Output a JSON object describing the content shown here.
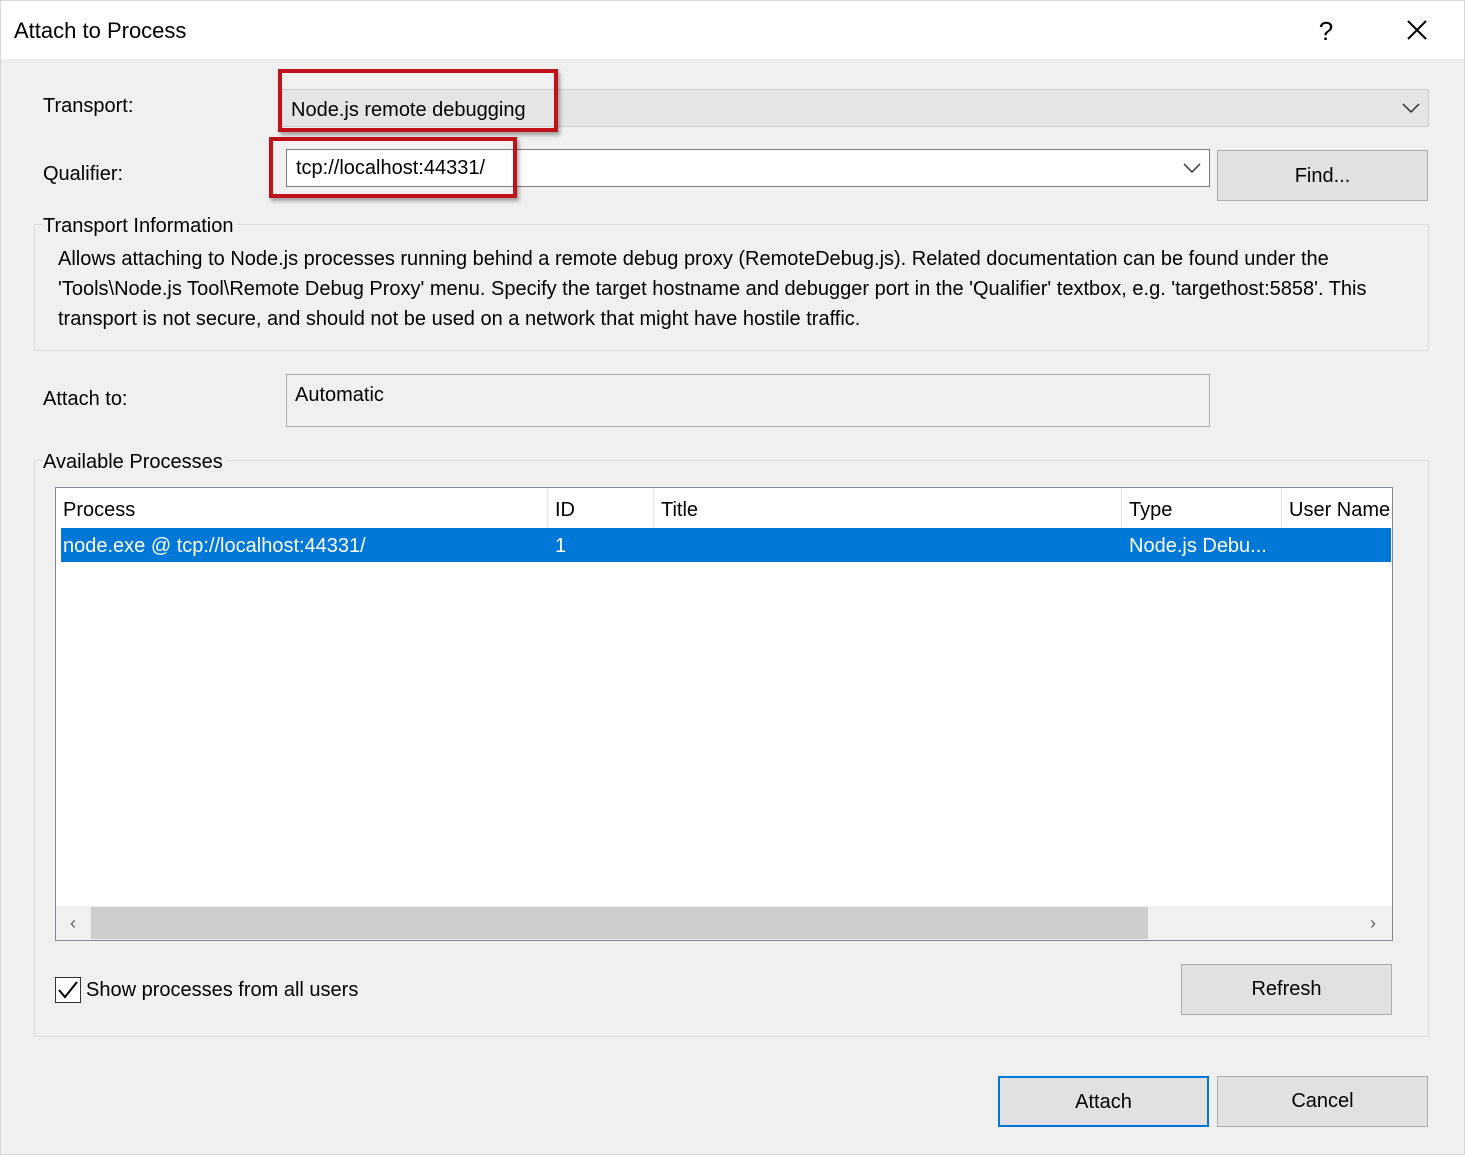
{
  "window": {
    "title": "Attach to Process",
    "help_label": "?",
    "close_icon": "close-icon"
  },
  "transport": {
    "label": "Transport:",
    "value": "Node.js remote debugging"
  },
  "qualifier": {
    "label": "Qualifier:",
    "value": "tcp://localhost:44331/",
    "find_button": "Find..."
  },
  "transport_info": {
    "title": "Transport Information",
    "text": "Allows attaching to Node.js processes running behind a remote debug proxy (RemoteDebug.js). Related documentation can be found under the 'Tools\\Node.js Tool\\Remote Debug Proxy' menu. Specify the target hostname and debugger port in the 'Qualifier' textbox, e.g. 'targethost:5858'. This transport is not secure, and should not be used on a network that might have hostile traffic."
  },
  "attach_to": {
    "label": "Attach to:",
    "value": "Automatic"
  },
  "processes": {
    "title": "Available Processes",
    "columns": [
      "Process",
      "ID",
      "Title",
      "Type",
      "User Name"
    ],
    "rows": [
      {
        "process": "node.exe @ tcp://localhost:44331/",
        "id": "1",
        "title": "",
        "type": "Node.js Debu...",
        "user": ""
      }
    ],
    "selected_row": 0,
    "show_all_users_label": "Show processes from all users",
    "show_all_users_checked": true,
    "refresh_button": "Refresh"
  },
  "footer": {
    "attach_button": "Attach",
    "cancel_button": "Cancel"
  },
  "colors": {
    "selection": "#0078d7",
    "highlight_box": "#c0121b",
    "dialog_bg": "#f0f0f0"
  }
}
